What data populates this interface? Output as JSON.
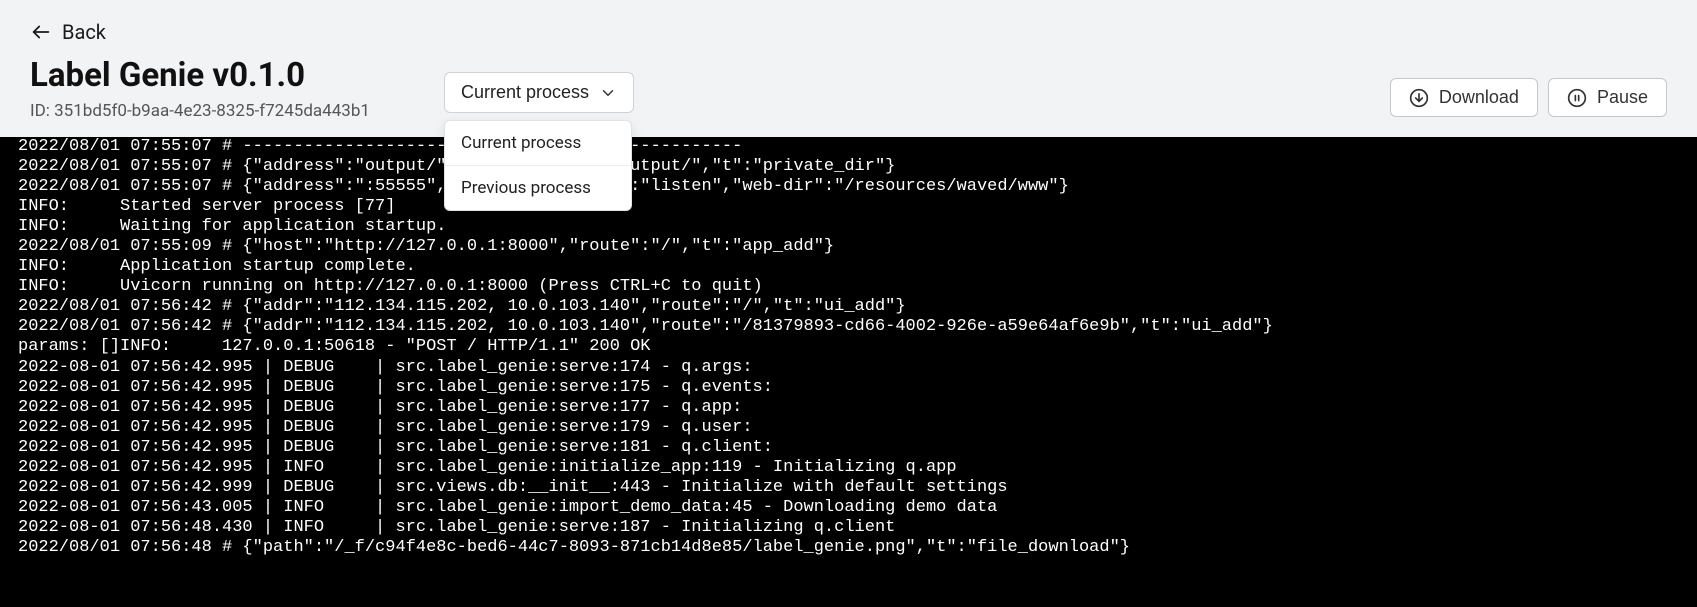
{
  "back": {
    "label": "Back"
  },
  "title": "Label Genie v0.1.0",
  "id_prefix": "ID: ",
  "id_value": "351bd5f0-b9aa-4e23-8325-f7245da443b1",
  "dropdown": {
    "selected": "Current process",
    "options": [
      "Current process",
      "Previous process"
    ]
  },
  "actions": {
    "download": "Download",
    "pause": "Pause"
  },
  "log_lines": [
    "2022/08/01 07:55:07 # -------------------------------------------------",
    "2022/08/01 07:55:07 # {\"address\":\"output/\",\"base-url\":\"/_f/output/\",\"t\":\"private_dir\"}",
    "2022/08/01 07:55:07 # {\"address\":\":55555\",\"base-url\":\"/\",\"t\":\"listen\",\"web-dir\":\"/resources/waved/www\"}",
    "INFO:     Started server process [77]",
    "INFO:     Waiting for application startup.",
    "2022/08/01 07:55:09 # {\"host\":\"http://127.0.0.1:8000\",\"route\":\"/\",\"t\":\"app_add\"}",
    "INFO:     Application startup complete.",
    "INFO:     Uvicorn running on http://127.0.0.1:8000 (Press CTRL+C to quit)",
    "2022/08/01 07:56:42 # {\"addr\":\"112.134.115.202, 10.0.103.140\",\"route\":\"/\",\"t\":\"ui_add\"}",
    "2022/08/01 07:56:42 # {\"addr\":\"112.134.115.202, 10.0.103.140\",\"route\":\"/81379893-cd66-4002-926e-a59e64af6e9b\",\"t\":\"ui_add\"}",
    "params: []INFO:     127.0.0.1:50618 - \"POST / HTTP/1.1\" 200 OK",
    "2022-08-01 07:56:42.995 | DEBUG    | src.label_genie:serve:174 - q.args:",
    "2022-08-01 07:56:42.995 | DEBUG    | src.label_genie:serve:175 - q.events:",
    "2022-08-01 07:56:42.995 | DEBUG    | src.label_genie:serve:177 - q.app:",
    "2022-08-01 07:56:42.995 | DEBUG    | src.label_genie:serve:179 - q.user:",
    "2022-08-01 07:56:42.995 | DEBUG    | src.label_genie:serve:181 - q.client:",
    "2022-08-01 07:56:42.995 | INFO     | src.label_genie:initialize_app:119 - Initializing q.app",
    "2022-08-01 07:56:42.999 | DEBUG    | src.views.db:__init__:443 - Initialize with default settings",
    "2022-08-01 07:56:43.005 | INFO     | src.label_genie:import_demo_data:45 - Downloading demo data",
    "2022-08-01 07:56:48.430 | INFO     | src.label_genie:serve:187 - Initializing q.client",
    "2022/08/01 07:56:48 # {\"path\":\"/_f/c94f4e8c-bed6-44c7-8093-871cb14d8e85/label_genie.png\",\"t\":\"file_download\"}"
  ]
}
